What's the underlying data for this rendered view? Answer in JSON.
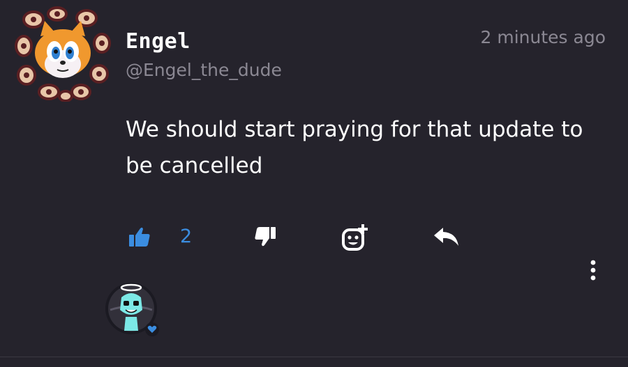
{
  "comment": {
    "author_name": "Engel",
    "author_handle": "@Engel_the_dude",
    "timestamp": "2 minutes ago",
    "body": "We should start praying for that update to be cancelled"
  },
  "actions": {
    "like_icon": "thumbs-up-icon",
    "like_count": "2",
    "like_color": "#3b8de0",
    "dislike_icon": "thumbs-down-icon",
    "react_icon": "add-reaction-icon",
    "reply_icon": "reply-icon",
    "more_icon": "more-vertical-icon"
  },
  "reactions": {
    "reactor_badge_icon": "heart-icon",
    "badge_color": "#3b8de0"
  },
  "theme": {
    "background": "#25232c",
    "text_primary": "#ffffff",
    "text_secondary": "#8b8893"
  }
}
